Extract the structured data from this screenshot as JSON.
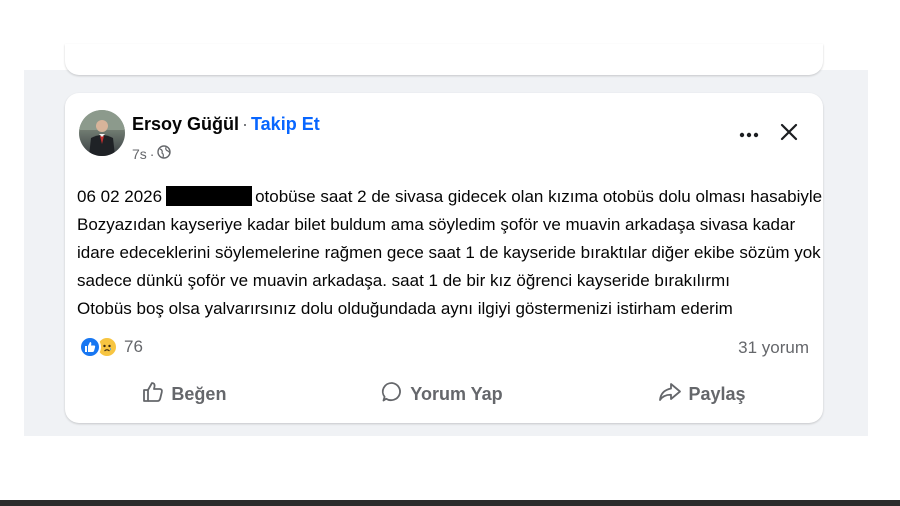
{
  "post": {
    "author": "Ersoy Güğül",
    "separator": "·",
    "follow_label": "Takip Et",
    "time": "7s",
    "text_lines": [
      {
        "before": "06 02 2026",
        "after": "otobüse saat 2 de sivasa gidecek olan kızıma otobüs dolu olması hasabiyle"
      },
      "Bozyazıdan kayseriye kadar bilet buldum ama söyledim şoför ve muavin arkadaşa sivasa kadar",
      "idare edeceklerini söylemelerine rağmen gece saat 1 de kayseride bıraktılar diğer ekibe sözüm yok",
      "sadece dünkü şoför ve muavin arkadaşa. saat 1 de bir kız öğrenci kayseride bırakılırmı",
      "Otobüs boş olsa yalvarırsınız dolu olduğundada aynı ilgiyi göstermenizi istirham ederim"
    ],
    "reaction_count": "76",
    "comment_count": "31 yorum"
  },
  "actions": {
    "like": "Beğen",
    "comment": "Yorum Yap",
    "share": "Paylaş"
  },
  "colors": {
    "link": "#0866ff",
    "secondary_text": "#65676b",
    "feed_background": "#f0f2f5",
    "like_reaction": "#1877f2",
    "sad_reaction": "#f7c541"
  },
  "icons": [
    "globe-icon",
    "more-options-icon",
    "close-icon",
    "like-reaction-icon",
    "sad-reaction-icon",
    "thumbs-up-icon",
    "comment-icon",
    "share-icon"
  ]
}
